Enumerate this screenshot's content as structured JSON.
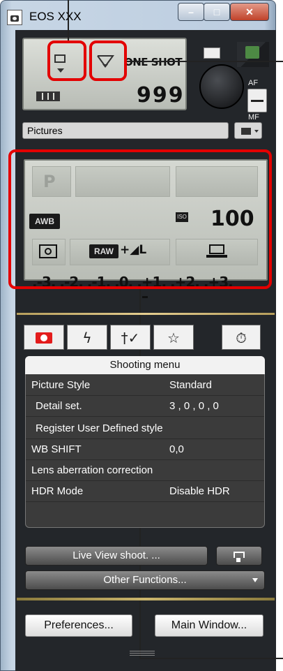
{
  "window": {
    "title": "EOS XXX"
  },
  "top_lcd": {
    "af_mode": "ONE SHOT",
    "shots_remaining": "999"
  },
  "af_switch": {
    "af_label": "AF",
    "mf_label": "MF"
  },
  "folder": {
    "name": "Pictures"
  },
  "main_lcd": {
    "mode": "P",
    "white_balance": "AWB",
    "iso_badge": "ISO",
    "iso_value": "100",
    "quality_raw": "RAW",
    "quality_rest": "+◢L",
    "exposure_scale": ".-3. .-2. .-1. .0. .+1. .+2. .+3."
  },
  "tabs": [
    {
      "icon": "camera-icon"
    },
    {
      "icon": "flash-icon",
      "glyph": "ϟ"
    },
    {
      "icon": "tools-icon",
      "glyph": "†✓"
    },
    {
      "icon": "star-icon",
      "glyph": "☆"
    },
    {
      "icon": "timer-icon",
      "glyph": "⏱"
    }
  ],
  "shooting_menu": {
    "title": "Shooting menu",
    "rows": [
      {
        "label": "Picture Style",
        "value": "Standard"
      },
      {
        "label": "Detail set.",
        "value": "3 , 0 , 0 , 0"
      },
      {
        "label": "Register User Defined style",
        "value": ""
      },
      {
        "label": "WB SHIFT",
        "value": "0,0"
      },
      {
        "label": "Lens aberration correction",
        "value": ""
      },
      {
        "label": "HDR Mode",
        "value": "Disable HDR"
      }
    ]
  },
  "buttons": {
    "live_view": "Live View shoot. ...",
    "other_functions": "Other Functions...",
    "preferences": "Preferences...",
    "main_window": "Main Window..."
  },
  "colors": {
    "annotation": "#e30000",
    "panel": "#23262a",
    "menu_bg": "#3b3b3b"
  }
}
